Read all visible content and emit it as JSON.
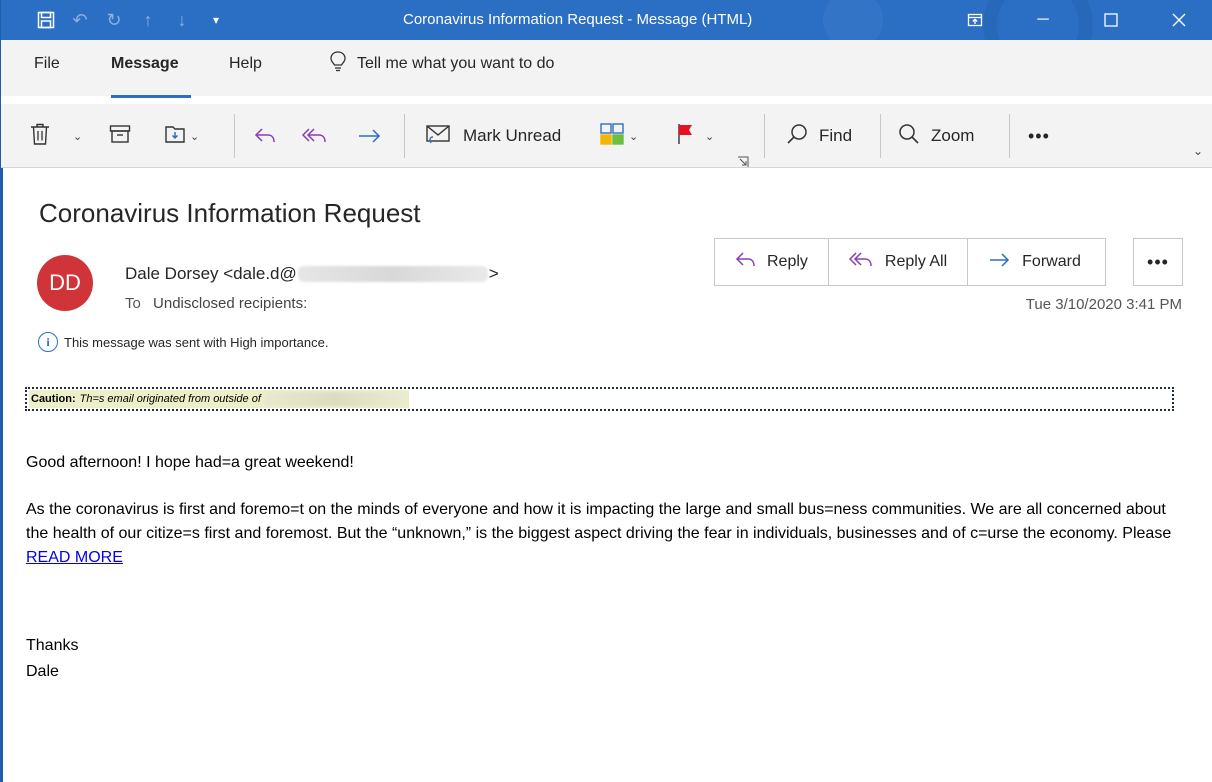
{
  "window": {
    "title": "Coronavirus Information Request  -  Message (HTML)",
    "icons": [
      "save-icon",
      "undo-icon",
      "redo-icon",
      "up-arrow-icon",
      "down-arrow-icon",
      "customize-qat-icon"
    ],
    "controls": [
      "ribbon-display-icon",
      "minimize-icon",
      "maximize-icon",
      "close-icon"
    ],
    "title_bar_color": "#2b6fc4"
  },
  "menu": {
    "items": [
      "File",
      "Message",
      "Help"
    ],
    "active": "Message",
    "tell_me": "Tell me what you want to do"
  },
  "ribbon": {
    "delete_icon": "trash-icon",
    "archive_icon": "archive-icon",
    "move_icon": "move-to-folder-icon",
    "reply_icon": "reply-icon",
    "reply_all_icon": "reply-all-icon",
    "forward_icon": "forward-icon",
    "mark_unread": "Mark Unread",
    "categorize_icon": "categorize-icon",
    "flag_icon": "flag-icon",
    "find": "Find",
    "zoom": "Zoom",
    "more": "•••"
  },
  "message": {
    "subject": "Coronavirus Information Request",
    "avatar_initials": "DD",
    "avatar_color": "#d13438",
    "sender_prefix": "Dale Dorsey <dale.d@",
    "sender_suffix": ">",
    "to_label": "To",
    "to_value": "Undisclosed recipients:",
    "date": "Tue 3/10/2020 3:41 PM",
    "importance_note": "This message was sent with High importance.",
    "actions": {
      "reply": "Reply",
      "reply_all": "Reply All",
      "forward": "Forward",
      "more": "•••"
    },
    "caution_label": "Caution:",
    "caution_text": "Th=s email originated from outside of",
    "greeting": "Good afternoon!   I hope had=a great weekend!",
    "paragraph": "As the coronavirus is first and foremo=t on the minds of everyone and how it is impacting the large and small bus=ness communities. We are all concerned about the health of our citize=s first and foremost.  But the “unknown,” is the biggest aspect driving the fear in individuals, businesses and of c=urse the economy. Please ",
    "link": "READ MORE",
    "signoff_1": "Thanks",
    "signoff_2": "Dale"
  }
}
